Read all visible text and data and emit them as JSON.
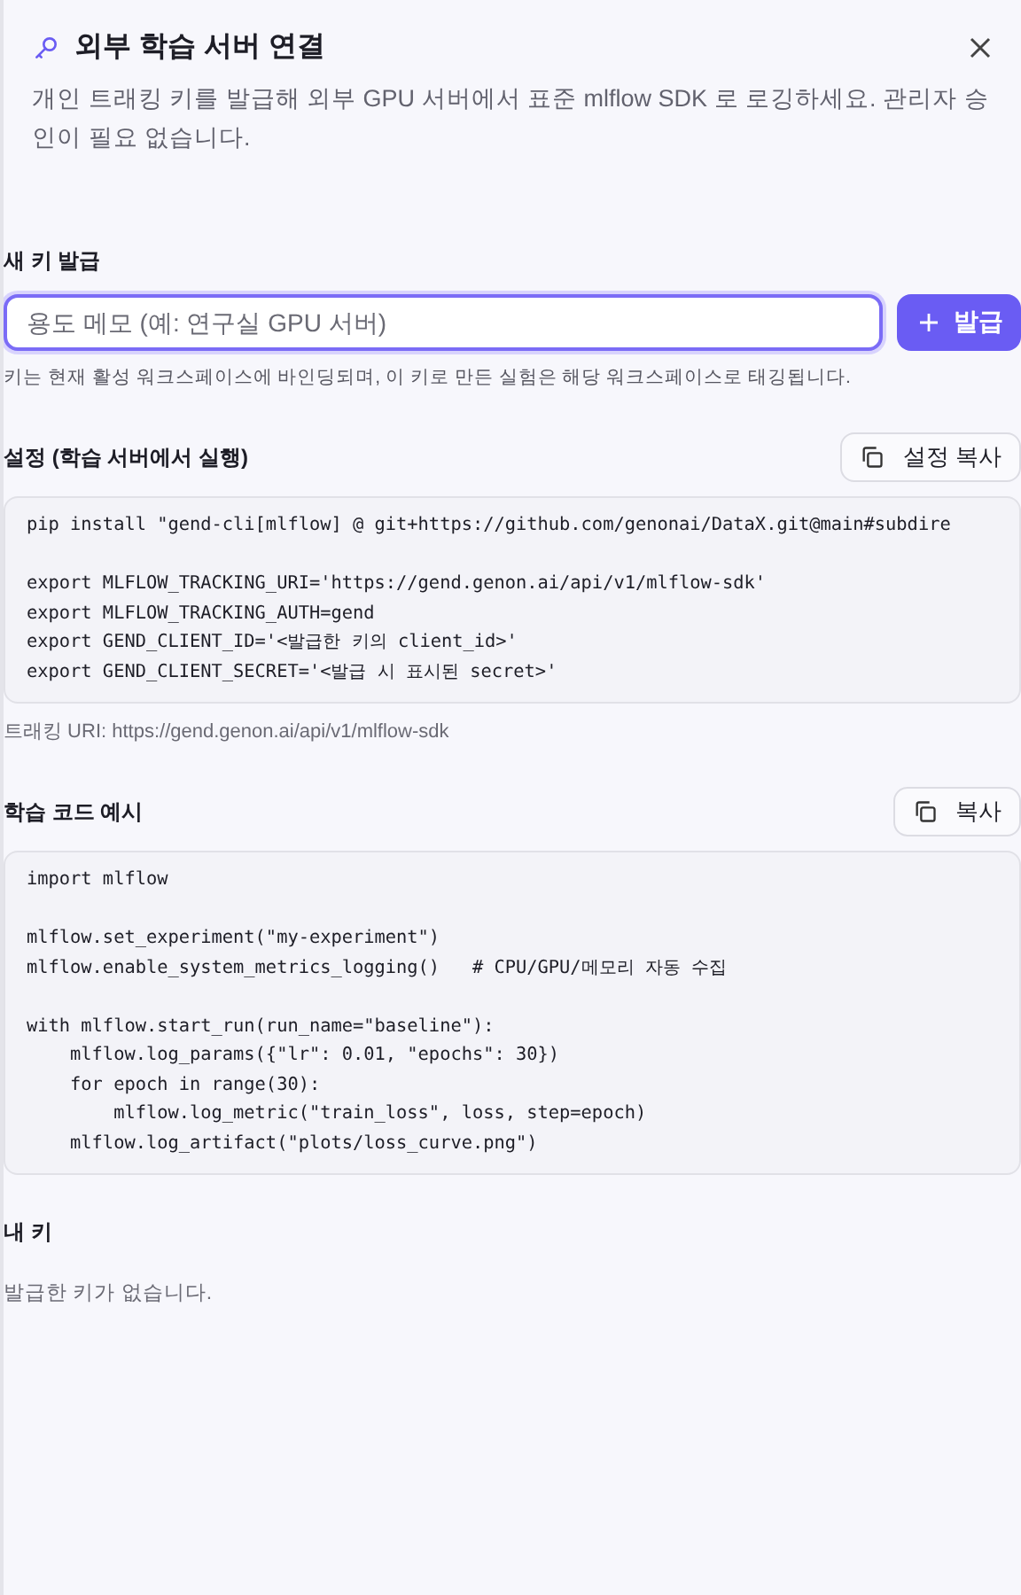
{
  "header": {
    "title": "외부 학습 서버 연결",
    "description": "개인 트래킹 키를 발급해 외부 GPU 서버에서 표준 mlflow SDK 로 로깅하세요. 관리자 승인이 필요 없습니다."
  },
  "new_key": {
    "label": "새 키 발급",
    "placeholder": "용도 메모 (예: 연구실 GPU 서버)",
    "button": "발급",
    "hint": "키는 현재 활성 워크스페이스에 바인딩되며, 이 키로 만든 실험은 해당 워크스페이스로 태깅됩니다."
  },
  "sections": [
    {
      "title": "설정 (학습 서버에서 실행)",
      "copy_button": "설정 복사",
      "code": "pip install \"gend-cli[mlflow] @ git+https://github.com/genonai/DataX.git@main#subdire\n\nexport MLFLOW_TRACKING_URI='https://gend.genon.ai/api/v1/mlflow-sdk'\nexport MLFLOW_TRACKING_AUTH=gend\nexport GEND_CLIENT_ID='<발급한 키의 client_id>'\nexport GEND_CLIENT_SECRET='<발급 시 표시된 secret>'",
      "note": "트래킹 URI: https://gend.genon.ai/api/v1/mlflow-sdk"
    },
    {
      "title": "학습 코드 예시",
      "copy_button": "복사",
      "code": "import mlflow\n\nmlflow.set_experiment(\"my-experiment\")\nmlflow.enable_system_metrics_logging()   # CPU/GPU/메모리 자동 수집\n\nwith mlflow.start_run(run_name=\"baseline\"):\n    mlflow.log_params({\"lr\": 0.01, \"epochs\": 30})\n    for epoch in range(30):\n        mlflow.log_metric(\"train_loss\", loss, step=epoch)\n    mlflow.log_artifact(\"plots/loss_curve.png\")"
    }
  ],
  "my_keys": {
    "title": "내 키",
    "empty": "발급한 키가 없습니다."
  }
}
